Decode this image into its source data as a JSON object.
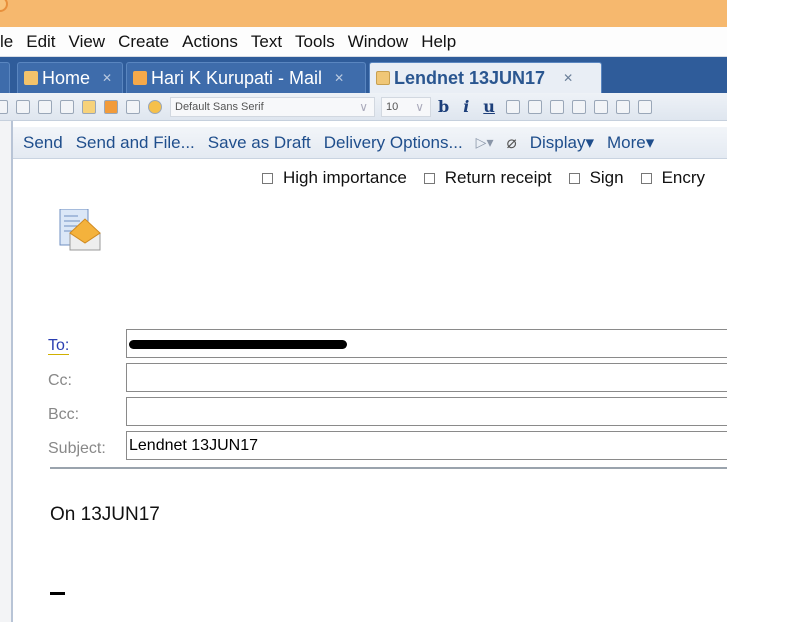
{
  "menu": [
    "le",
    "Edit",
    "View",
    "Create",
    "Actions",
    "Text",
    "Tools",
    "Window",
    "Help"
  ],
  "tabs": [
    {
      "label": "Home",
      "icon": "home-icon"
    },
    {
      "label": "Hari K Kurupati - Mail",
      "icon": "mail-icon"
    },
    {
      "label": "Lendnet  13JUN17",
      "icon": "memo-icon",
      "active": true
    }
  ],
  "toolbar": {
    "font": "Default Sans Serif",
    "size": "10",
    "bold": "b",
    "italic": "i",
    "underline": "u"
  },
  "actions": [
    "Send",
    "Send and File...",
    "Save as Draft",
    "Delivery Options...",
    "▷▾",
    "Display▾",
    "More▾"
  ],
  "options": [
    {
      "label": "High importance",
      "checked": false
    },
    {
      "label": "Return receipt",
      "checked": false
    },
    {
      "label": "Sign",
      "checked": false
    },
    {
      "label": "Encry",
      "checked": false
    }
  ],
  "header": {
    "to_label": "To:",
    "cc_label": "Cc:",
    "bcc_label": "Bcc:",
    "subject_label": "Subject:",
    "cc": "",
    "bcc": "",
    "subject": "Lendnet  13JUN17"
  },
  "body": {
    "line1": "On  13JUN17"
  },
  "colors": {
    "titlebar": "#f6b86e",
    "tabbar": "#2f5c9a",
    "action_text": "#1f4e8c"
  }
}
